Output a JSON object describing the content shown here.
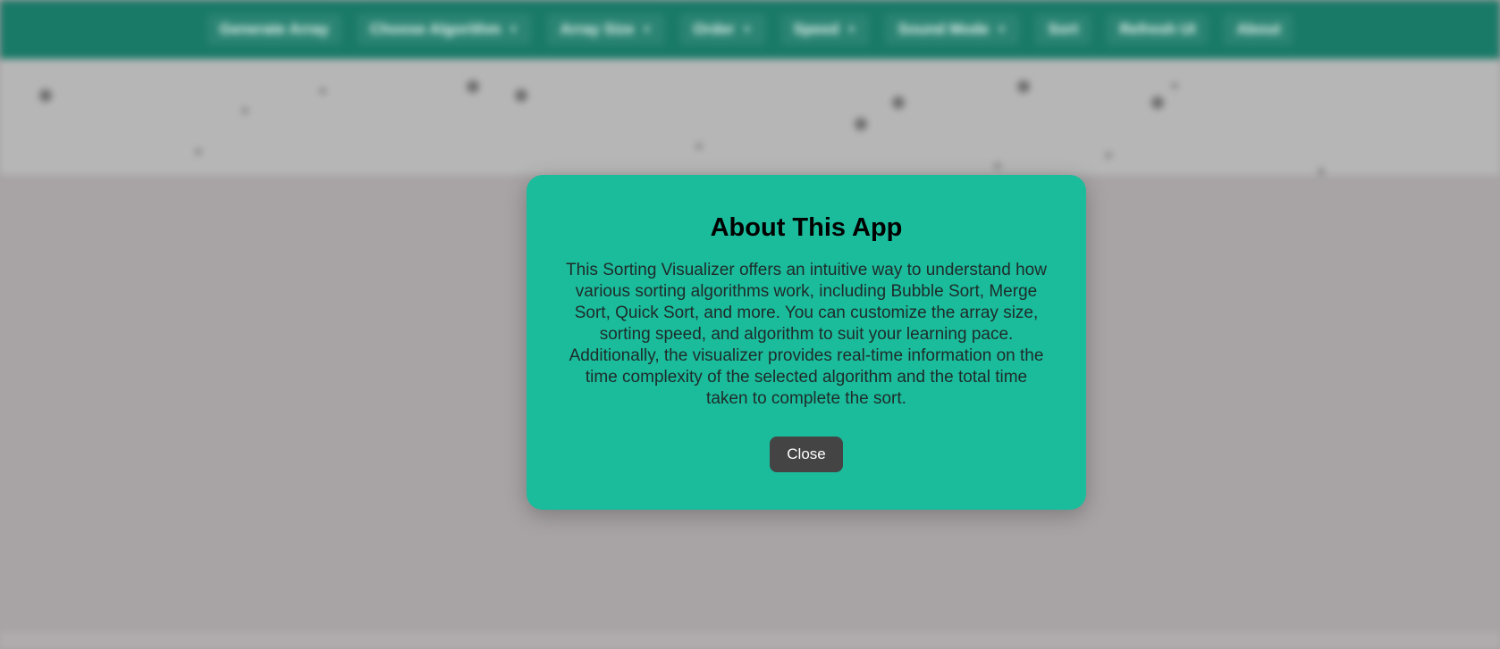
{
  "navbar": {
    "items": [
      {
        "label": "Generate Array",
        "has_dropdown": false
      },
      {
        "label": "Choose Algorithm",
        "has_dropdown": true
      },
      {
        "label": "Array Size",
        "has_dropdown": true
      },
      {
        "label": "Order",
        "has_dropdown": true
      },
      {
        "label": "Speed",
        "has_dropdown": true
      },
      {
        "label": "Sound Mode",
        "has_dropdown": true
      },
      {
        "label": "Sort",
        "has_dropdown": false
      },
      {
        "label": "Refresh UI",
        "has_dropdown": false
      },
      {
        "label": "About",
        "has_dropdown": false
      }
    ]
  },
  "modal": {
    "title": "About This App",
    "body": "This Sorting Visualizer offers an intuitive way to understand how various sorting algorithms work, including Bubble Sort, Merge Sort, Quick Sort, and more. You can customize the array size, sorting speed, and algorithm to suit your learning pace. Additionally, the visualizer provides real-time information on the time complexity of the selected algorithm and the total time taken to complete the sort.",
    "close_label": "Close"
  },
  "colors": {
    "navbar": "#1a7a68",
    "modal": "#1abc9c",
    "close_button": "#444444",
    "overlay": "#a8a4a5"
  }
}
